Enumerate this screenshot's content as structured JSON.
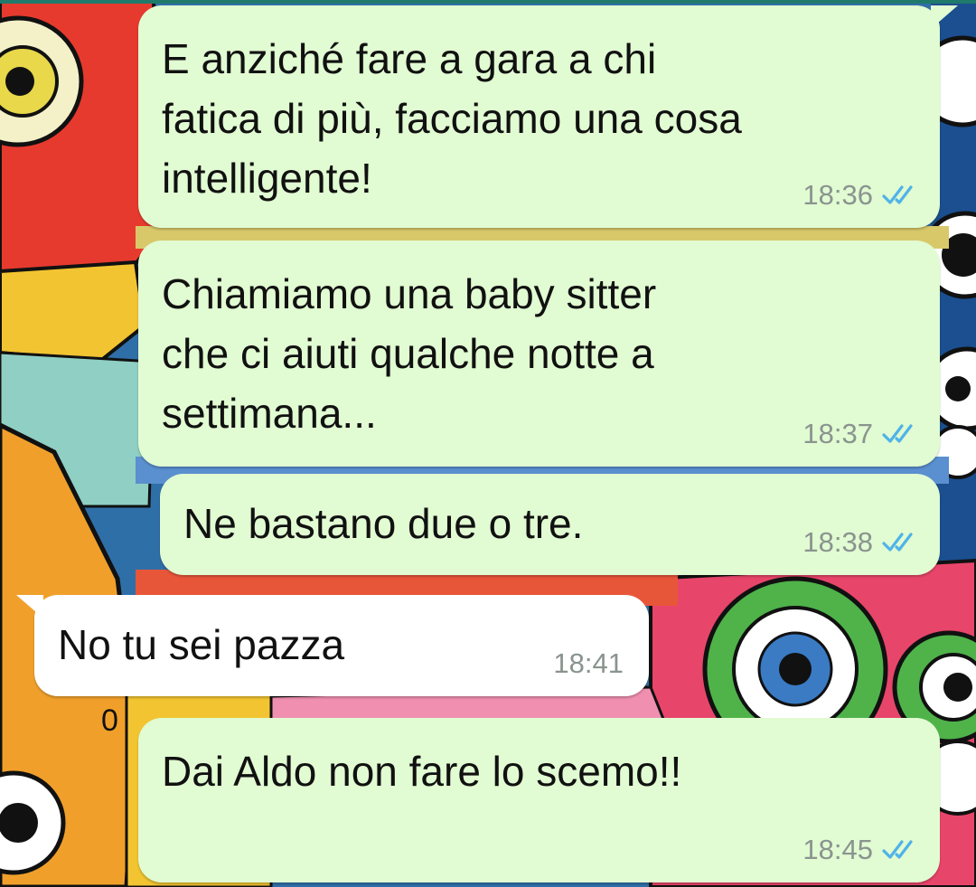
{
  "conversation": {
    "messages": [
      {
        "text": "E anziché fare a gara a chi\nfatica di più, facciamo una cosa\nintelligente!",
        "time": "18:36",
        "direction": "outgoing",
        "read_icon": "double-check-icon"
      },
      {
        "text": "Chiamiamo una baby sitter\nche ci aiuti qualche notte a\nsettimana...",
        "time": "18:37",
        "direction": "outgoing",
        "read_icon": "double-check-icon"
      },
      {
        "text": "Ne bastano due o tre.",
        "time": "18:38",
        "direction": "outgoing",
        "read_icon": "double-check-icon"
      },
      {
        "text": "No tu sei pazza",
        "time": "18:41",
        "direction": "incoming"
      },
      {
        "text": "Dai Aldo non fare lo scemo!!",
        "time": "18:45",
        "direction": "outgoing",
        "read_icon": "double-check-icon"
      }
    ]
  },
  "colors": {
    "outgoing_bubble": "#e1fbd2",
    "incoming_bubble": "#ffffff",
    "read_ticks": "#4fb3e8",
    "time_text": "#8a948f"
  }
}
